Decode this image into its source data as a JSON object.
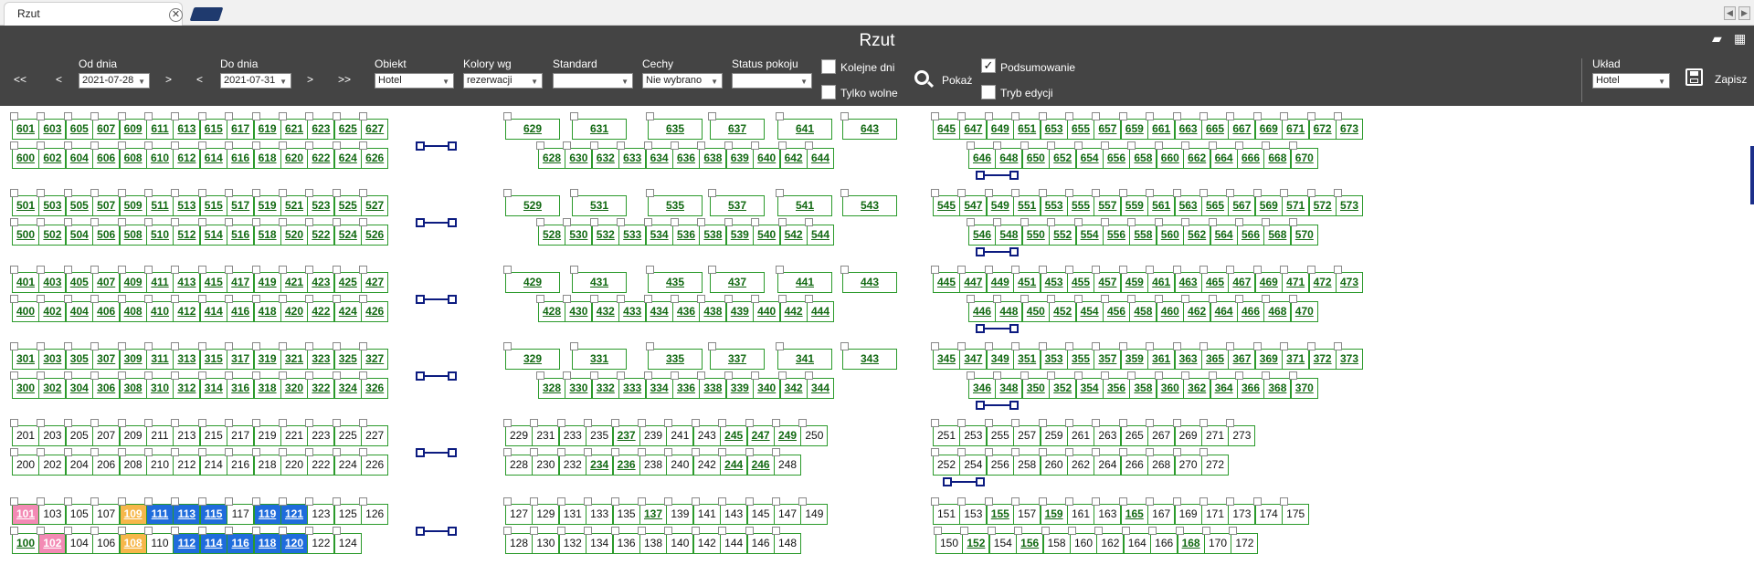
{
  "tab": {
    "title": "Rzut",
    "close": "✕"
  },
  "header": {
    "title": "Rzut"
  },
  "nav": {
    "first": "<<",
    "prev": "<",
    "next": ">",
    "last": ">>"
  },
  "filters": {
    "od_label": "Od dnia",
    "od_value": "2021-07-28",
    "do_label": "Do dnia",
    "do_value": "2021-07-31",
    "obiekt_label": "Obiekt",
    "obiekt_value": "Hotel",
    "kolory_label": "Kolory wg",
    "kolory_value": "rezerwacji",
    "standard_label": "Standard",
    "standard_value": "",
    "cechy_label": "Cechy",
    "cechy_value": "Nie wybrano",
    "status_label": "Status pokoju",
    "status_value": ""
  },
  "options": {
    "kolejne_dni": "Kolejne dni",
    "kolejne_dni_checked": false,
    "tylko_wolne": "Tylko wolne",
    "tylko_wolne_checked": false,
    "podsumowanie": "Podsumowanie",
    "podsumowanie_checked": true,
    "tryb_edycji": "Tryb edycji",
    "tryb_edycji_checked": false,
    "check_mark": "✓"
  },
  "actions": {
    "pokaz": "Pokaż",
    "zapisz": "Zapisz"
  },
  "uklad": {
    "label": "Układ",
    "value": "Hotel"
  },
  "colors": {
    "pink": "#f38ab4",
    "orange": "#f6b74a",
    "blue": "#1f6cdc",
    "room_border": "#2b9a2b",
    "room_text": "#126912"
  },
  "floors": {
    "f6": {
      "top_left": [
        "601",
        "603",
        "605",
        "607",
        "609",
        "611",
        "613",
        "615",
        "617",
        "619",
        "621",
        "623",
        "625",
        "627"
      ],
      "bottom_left": [
        "600",
        "602",
        "604",
        "606",
        "608",
        "610",
        "612",
        "614",
        "616",
        "618",
        "620",
        "622",
        "624",
        "626"
      ],
      "top_mid": [
        "629",
        "631",
        "635",
        "637",
        "641",
        "643"
      ],
      "bottom_mid": [
        "628",
        "630",
        "632",
        "633",
        "634",
        "636",
        "638",
        "639",
        "640",
        "642",
        "644"
      ],
      "top_right": [
        "645",
        "647",
        "649",
        "651",
        "653",
        "655",
        "657",
        "659",
        "661",
        "663",
        "665",
        "667",
        "669",
        "671",
        "672",
        "673"
      ],
      "bottom_right": [
        "646",
        "648",
        "650",
        "652",
        "654",
        "656",
        "658",
        "660",
        "662",
        "664",
        "666",
        "668",
        "670"
      ]
    },
    "f5": {
      "top_left": [
        "501",
        "503",
        "505",
        "507",
        "509",
        "511",
        "513",
        "515",
        "517",
        "519",
        "521",
        "523",
        "525",
        "527"
      ],
      "bottom_left": [
        "500",
        "502",
        "504",
        "506",
        "508",
        "510",
        "512",
        "514",
        "516",
        "518",
        "520",
        "522",
        "524",
        "526"
      ],
      "top_mid": [
        "529",
        "531",
        "535",
        "537",
        "541",
        "543"
      ],
      "bottom_mid": [
        "528",
        "530",
        "532",
        "533",
        "534",
        "536",
        "538",
        "539",
        "540",
        "542",
        "544"
      ],
      "top_right": [
        "545",
        "547",
        "549",
        "551",
        "553",
        "555",
        "557",
        "559",
        "561",
        "563",
        "565",
        "567",
        "569",
        "571",
        "572",
        "573"
      ],
      "bottom_right": [
        "546",
        "548",
        "550",
        "552",
        "554",
        "556",
        "558",
        "560",
        "562",
        "564",
        "566",
        "568",
        "570"
      ]
    },
    "f4": {
      "top_left": [
        "401",
        "403",
        "405",
        "407",
        "409",
        "411",
        "413",
        "415",
        "417",
        "419",
        "421",
        "423",
        "425",
        "427"
      ],
      "bottom_left": [
        "400",
        "402",
        "404",
        "406",
        "408",
        "410",
        "412",
        "414",
        "416",
        "418",
        "420",
        "422",
        "424",
        "426"
      ],
      "top_mid": [
        "429",
        "431",
        "435",
        "437",
        "441",
        "443"
      ],
      "bottom_mid": [
        "428",
        "430",
        "432",
        "433",
        "434",
        "436",
        "438",
        "439",
        "440",
        "442",
        "444"
      ],
      "top_right": [
        "445",
        "447",
        "449",
        "451",
        "453",
        "455",
        "457",
        "459",
        "461",
        "463",
        "465",
        "467",
        "469",
        "471",
        "472",
        "473"
      ],
      "bottom_right": [
        "446",
        "448",
        "450",
        "452",
        "454",
        "456",
        "458",
        "460",
        "462",
        "464",
        "466",
        "468",
        "470"
      ]
    },
    "f3": {
      "top_left": [
        "301",
        "303",
        "305",
        "307",
        "309",
        "311",
        "313",
        "315",
        "317",
        "319",
        "321",
        "323",
        "325",
        "327"
      ],
      "bottom_left": [
        "300",
        "302",
        "304",
        "306",
        "308",
        "310",
        "312",
        "314",
        "316",
        "318",
        "320",
        "322",
        "324",
        "326"
      ],
      "top_mid": [
        "329",
        "331",
        "335",
        "337",
        "341",
        "343"
      ],
      "bottom_mid": [
        "328",
        "330",
        "332",
        "333",
        "334",
        "336",
        "338",
        "339",
        "340",
        "342",
        "344"
      ],
      "top_right": [
        "345",
        "347",
        "349",
        "351",
        "353",
        "355",
        "357",
        "359",
        "361",
        "363",
        "365",
        "367",
        "369",
        "371",
        "372",
        "373"
      ],
      "bottom_right": [
        "346",
        "348",
        "350",
        "352",
        "354",
        "356",
        "358",
        "360",
        "362",
        "364",
        "366",
        "368",
        "370"
      ]
    },
    "f2": {
      "top_left": [
        "201",
        "203",
        "205",
        "207",
        "209",
        "211",
        "213",
        "215",
        "217",
        "219",
        "221",
        "223",
        "225",
        "227"
      ],
      "bottom_left": [
        "200",
        "202",
        "204",
        "206",
        "208",
        "210",
        "212",
        "214",
        "216",
        "218",
        "220",
        "222",
        "224",
        "226"
      ],
      "top_mid": [
        "229",
        "231",
        "233",
        "235",
        "237",
        "239",
        "241",
        "243",
        "245",
        "247",
        "249",
        "250"
      ],
      "bottom_mid": [
        "228",
        "230",
        "232",
        "234",
        "236",
        "238",
        "240",
        "242",
        "244",
        "246",
        "248"
      ],
      "top_right": [
        "251",
        "253",
        "255",
        "257",
        "259",
        "261",
        "263",
        "265",
        "267",
        "269",
        "271",
        "273"
      ],
      "bottom_right": [
        "252",
        "254",
        "256",
        "258",
        "260",
        "262",
        "264",
        "266",
        "268",
        "270",
        "272"
      ]
    },
    "f1": {
      "top_left": [
        "101",
        "103",
        "105",
        "107",
        "109",
        "111",
        "113",
        "115",
        "117",
        "119",
        "121",
        "123",
        "125",
        "126"
      ],
      "bottom_left": [
        "100",
        "102",
        "104",
        "106",
        "108",
        "110",
        "112",
        "114",
        "116",
        "118",
        "120",
        "122",
        "124"
      ],
      "top_mid": [
        "127",
        "129",
        "131",
        "133",
        "135",
        "137",
        "139",
        "141",
        "143",
        "145",
        "147",
        "149"
      ],
      "bottom_mid": [
        "128",
        "130",
        "132",
        "134",
        "136",
        "138",
        "140",
        "142",
        "144",
        "146",
        "148"
      ],
      "top_right": [
        "151",
        "153",
        "155",
        "157",
        "159",
        "161",
        "163",
        "165",
        "167",
        "169",
        "171",
        "173",
        "174",
        "175"
      ],
      "bottom_right": [
        "150",
        "152",
        "154",
        "156",
        "158",
        "160",
        "162",
        "164",
        "166",
        "168",
        "170",
        "172"
      ]
    }
  },
  "status": {
    "pink": [
      "101",
      "102"
    ],
    "orange": [
      "109",
      "108"
    ],
    "blue": [
      "111",
      "113",
      "115",
      "119",
      "121",
      "112",
      "114",
      "116",
      "118",
      "120"
    ],
    "plain": [
      "103",
      "105",
      "107",
      "117",
      "123",
      "125",
      "126",
      "104",
      "106",
      "110",
      "122",
      "124",
      "127",
      "129",
      "131",
      "133",
      "135",
      "139",
      "141",
      "143",
      "145",
      "147",
      "149",
      "128",
      "130",
      "132",
      "134",
      "136",
      "138",
      "140",
      "142",
      "144",
      "146",
      "148",
      "151",
      "153",
      "157",
      "161",
      "163",
      "167",
      "169",
      "171",
      "173",
      "174",
      "175",
      "150",
      "154",
      "158",
      "160",
      "162",
      "164",
      "166",
      "170",
      "172",
      "219",
      "221",
      "229",
      "231",
      "233",
      "235",
      "239",
      "241",
      "243",
      "250",
      "228",
      "230",
      "232",
      "238",
      "240",
      "242",
      "248",
      "200",
      "202",
      "208",
      "210",
      "212",
      "214",
      "216",
      "218",
      "220",
      "222",
      "224",
      "251",
      "253",
      "255",
      "257",
      "259",
      "261",
      "263",
      "265",
      "267",
      "269",
      "271",
      "273",
      "252",
      "254",
      "256",
      "258",
      "260",
      "262",
      "264",
      "266",
      "268",
      "270",
      "272",
      "201",
      "203",
      "205",
      "207",
      "209",
      "211",
      "213",
      "215",
      "217",
      "223",
      "225",
      "227",
      "204",
      "206",
      "226"
    ]
  }
}
